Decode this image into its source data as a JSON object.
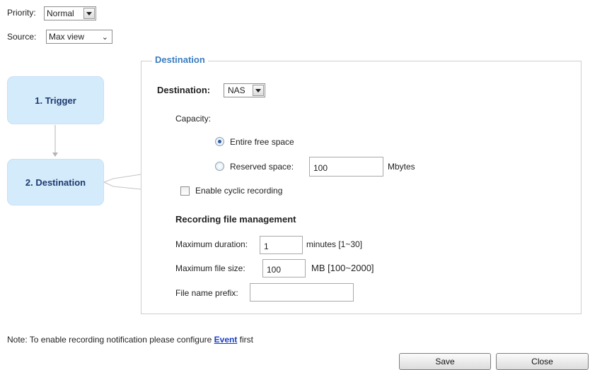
{
  "top": {
    "priority_label": "Priority:",
    "priority_value": "Normal",
    "source_label": "Source:",
    "source_value": "Max view"
  },
  "flow": {
    "step1": "1. Trigger",
    "step2": "2. Destination"
  },
  "destination": {
    "legend": "Destination",
    "label": "Destination:",
    "value": "NAS",
    "capacity_label": "Capacity:",
    "entire_free_space": "Entire free space",
    "reserved_space": "Reserved space:",
    "reserved_value": "100",
    "reserved_unit": "Mbytes",
    "selected_capacity": "Entire free space",
    "cyclic": "Enable cyclic recording",
    "cyclic_checked": false
  },
  "file_mgmt": {
    "title": "Recording file management",
    "max_duration_label": "Maximum duration:",
    "max_duration_value": "1",
    "max_duration_unit": "minutes [1~30]",
    "max_size_label": "Maximum file size:",
    "max_size_value": "100",
    "max_size_unit": "MB [100~2000]",
    "prefix_label": "File name prefix:",
    "prefix_value": ""
  },
  "footer": {
    "note_before": "Note: To enable recording notification please configure ",
    "note_link": "Event",
    "note_after": " first",
    "save": "Save",
    "close": "Close"
  }
}
